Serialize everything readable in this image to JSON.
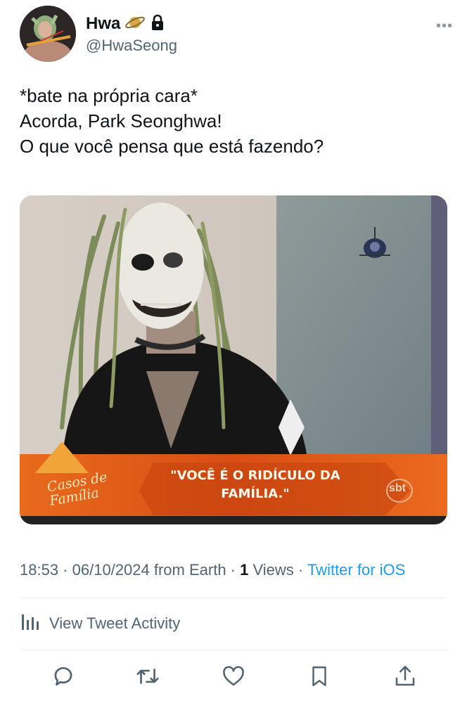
{
  "user": {
    "display_name": "Hwa",
    "handle": "@HwaSeong",
    "badges": [
      "saturn-emoji",
      "lock-icon"
    ]
  },
  "tweet": {
    "lines": [
      "*bate na própria cara*",
      "Acorda, Park Seonghwa!",
      "O que você pensa que está fazendo?"
    ]
  },
  "media": {
    "show_logo": "Casos de Família",
    "caption_line1": "\"VOCÊ É O RIDÍCULO DA",
    "caption_line2": "FAMÍLIA.\"",
    "channel_logo": "sbt"
  },
  "meta": {
    "time": "18:53",
    "date": "06/10/2024",
    "location": "from Earth",
    "views_count": "1",
    "views_label": "Views",
    "source": "Twitter for iOS"
  },
  "activity": {
    "label": "View Tweet Activity"
  },
  "actions": [
    "reply-icon",
    "retweet-icon",
    "like-icon",
    "bookmark-icon",
    "share-icon"
  ],
  "colors": {
    "text": "#0f1419",
    "secondary": "#536471",
    "link": "#1d9bf0",
    "divider": "#eff3f4",
    "banner": "#e2581b"
  }
}
